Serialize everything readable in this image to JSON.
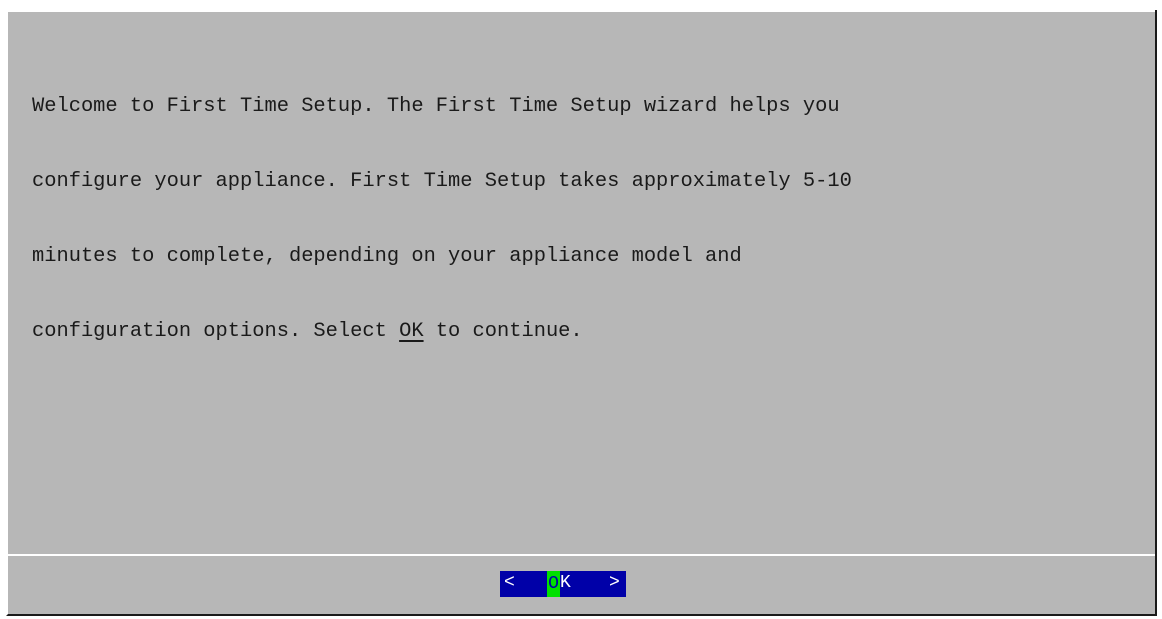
{
  "dialog": {
    "message_lines": [
      "Welcome to First Time Setup. The First Time Setup wizard helps you",
      "configure your appliance. First Time Setup takes approximately 5-10",
      "minutes to complete, depending on your appliance model and"
    ],
    "last_line_prefix": "configuration options. Select ",
    "last_line_ok": "OK",
    "last_line_suffix": " to continue."
  },
  "button": {
    "bracket_left": "<",
    "hotkey_letter": "O",
    "rest_label": "K",
    "bracket_right": ">"
  },
  "colors": {
    "dialog_bg": "#b7b7b7",
    "button_bg": "#0000a8",
    "hotkey_bg": "#00e000",
    "text": "#1a1a1a"
  }
}
